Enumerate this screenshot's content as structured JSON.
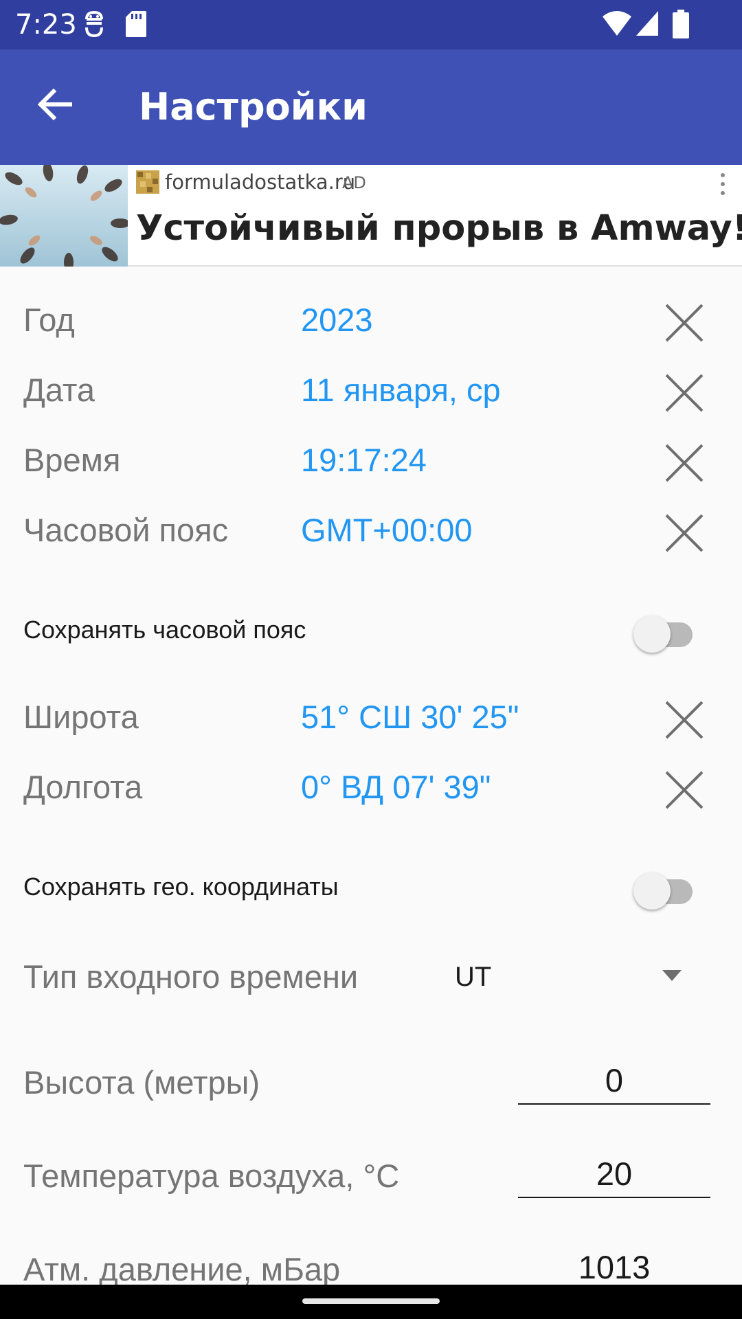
{
  "status_bar": {
    "time": "7:23",
    "icons": [
      "android-debug-icon",
      "sd-card-icon",
      "wifi-icon",
      "signal-icon",
      "battery-icon"
    ]
  },
  "app_bar": {
    "title": "Настройки",
    "back_icon": "arrow-back-icon"
  },
  "ad": {
    "domain": "formuladostatka.ru",
    "tag": "AD",
    "headline": "Устойчивый прорыв в Amway!"
  },
  "settings": {
    "year": {
      "label": "Год",
      "value": "2023"
    },
    "date": {
      "label": "Дата",
      "value": "11 января, ср"
    },
    "time": {
      "label": "Время",
      "value": "19:17:24"
    },
    "timezone": {
      "label": "Часовой пояс",
      "value": "GMT+00:00"
    },
    "save_timezone": {
      "label": "Сохранять часовой пояс",
      "checked": false
    },
    "latitude": {
      "label": "Широта",
      "value": "51° СШ 30' 25\""
    },
    "longitude": {
      "label": "Долгота",
      "value": "0° ВД 07' 39\""
    },
    "save_geo": {
      "label": "Сохранять гео. координаты",
      "checked": false
    },
    "input_time_type": {
      "label": "Тип входного времени",
      "selected": "UT"
    },
    "altitude": {
      "label": "Высота (метры)",
      "value": "0"
    },
    "air_temperature": {
      "label": "Температура воздуха, °C",
      "value": "20"
    },
    "pressure": {
      "label": "Атм. давление, мБар",
      "value": "1013"
    }
  },
  "colors": {
    "status_bar": "#303f9f",
    "app_bar": "#3f51b5",
    "value_text": "#2196f3",
    "label_text": "#757575",
    "background": "#fafafa"
  }
}
